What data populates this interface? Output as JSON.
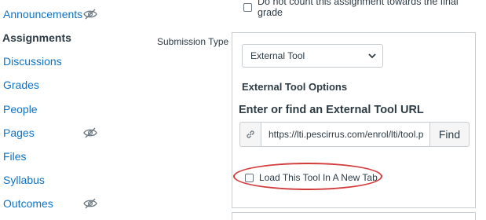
{
  "nav": {
    "items": [
      {
        "label": "Announcements",
        "hidden_icon": true,
        "active": false
      },
      {
        "label": "Assignments",
        "hidden_icon": false,
        "active": true
      },
      {
        "label": "Discussions",
        "hidden_icon": false,
        "active": false
      },
      {
        "label": "Grades",
        "hidden_icon": false,
        "active": false
      },
      {
        "label": "People",
        "hidden_icon": false,
        "active": false
      },
      {
        "label": "Pages",
        "hidden_icon": true,
        "active": false
      },
      {
        "label": "Files",
        "hidden_icon": false,
        "active": false
      },
      {
        "label": "Syllabus",
        "hidden_icon": false,
        "active": false
      },
      {
        "label": "Outcomes",
        "hidden_icon": true,
        "active": false
      }
    ]
  },
  "form": {
    "final_grade_checkbox_label": "Do not count this assignment towards the final grade",
    "submission_type_label": "Submission Type",
    "submission_type_value": "External Tool",
    "external_tool_options_heading": "External Tool Options",
    "url_heading": "Enter or find an External Tool URL",
    "url_value": "https://lti.pescirrus.com/enrol/lti/tool.p",
    "find_button_label": "Find",
    "new_tab_checkbox_label": "Load This Tool In A New Tab"
  },
  "icons": {
    "hidden": "eye-slash-icon",
    "link": "link-icon",
    "dropdown": "chevron-down-icon"
  },
  "colors": {
    "link_blue": "#0e72c4",
    "text": "#2d3b45",
    "highlight_red": "#d33a3a",
    "border": "#c7cdd1"
  }
}
